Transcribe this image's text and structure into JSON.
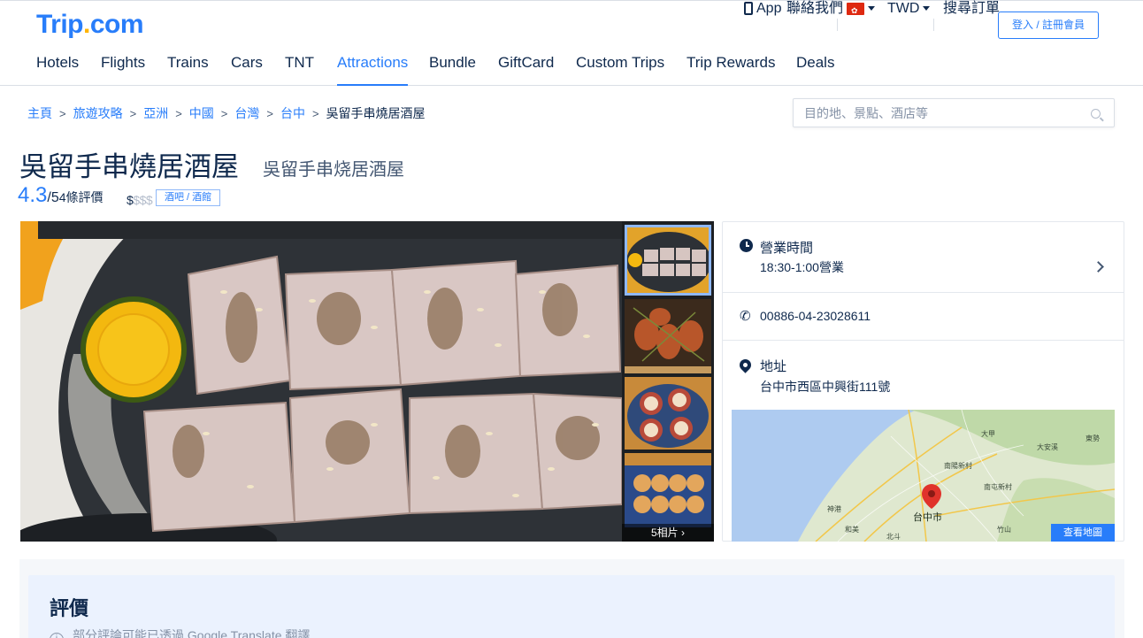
{
  "header": {
    "logo_main": "Trip",
    "logo_dot": ".",
    "logo_tld": "com",
    "app_label": "App",
    "contact_label": "聯絡我們",
    "currency": "TWD",
    "find_booking_label": "搜尋訂單",
    "login_label": "登入 / 註冊會員"
  },
  "nav": {
    "items": [
      "Hotels",
      "Flights",
      "Trains",
      "Cars",
      "TNT",
      "Attractions",
      "Bundle",
      "GiftCard",
      "Custom Trips",
      "Trip Rewards",
      "Deals"
    ],
    "active": "Attractions"
  },
  "breadcrumb": {
    "items": [
      "主頁",
      "旅遊攻略",
      "亞洲",
      "中國",
      "台灣",
      "台中"
    ],
    "current": "吳留手串燒居酒屋"
  },
  "search": {
    "placeholder": "目的地、景點、酒店等"
  },
  "place": {
    "title": "吳留手串燒居酒屋",
    "subtitle": "吳留手串烧居酒屋",
    "score": "4.3",
    "score_max": "/5",
    "review_count": "4條評價",
    "price_active": "$",
    "price_inactive": "$$$",
    "tag": "酒吧 / 酒館"
  },
  "gallery": {
    "photo_count_label": "5相片"
  },
  "info": {
    "hours_title": "營業時間",
    "hours_value": "18:30-1:00營業",
    "phone": "00886-04-23028611",
    "address_title": "地址",
    "address_value": "台中市西區中興街111號",
    "map_button_label": "查看地圖",
    "map_city_label": "台中市",
    "map_labels": [
      "大甲",
      "東勢",
      "大安溪",
      "南陽新村",
      "南屯新村",
      "神港",
      "和美",
      "竹山",
      "北斗"
    ]
  },
  "reviews": {
    "title": "評價",
    "note": "部分評論可能已透過 Google Translate 翻譯"
  },
  "colors": {
    "brand": "#287dfa",
    "text": "#0f294d",
    "logo_accent": "#ffb400"
  }
}
